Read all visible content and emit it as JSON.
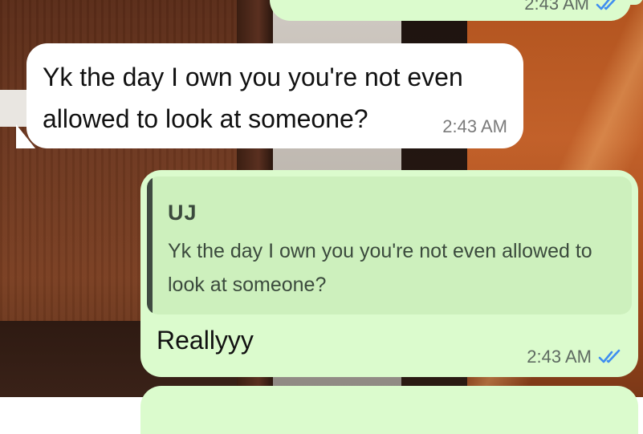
{
  "chat": {
    "top_message": {
      "time": "2:43 AM",
      "status_icon": "double-check-read-icon"
    },
    "received_message": {
      "text": "Yk the day I own you you're not even allowed to look at someone?",
      "time": "2:43 AM"
    },
    "reply_message": {
      "quote": {
        "author": "UJ",
        "text": "Yk the day I own you you're not even allowed to look at someone?"
      },
      "text": "Reallyyy",
      "time": "2:43 AM",
      "status_icon": "double-check-read-icon"
    }
  },
  "colors": {
    "sent_bubble": "#dbfbcd",
    "received_bubble": "#ffffff",
    "quote_background": "#cdf0bd",
    "quote_bar": "#3f4a41",
    "read_ticks": "#3f8ef0"
  }
}
